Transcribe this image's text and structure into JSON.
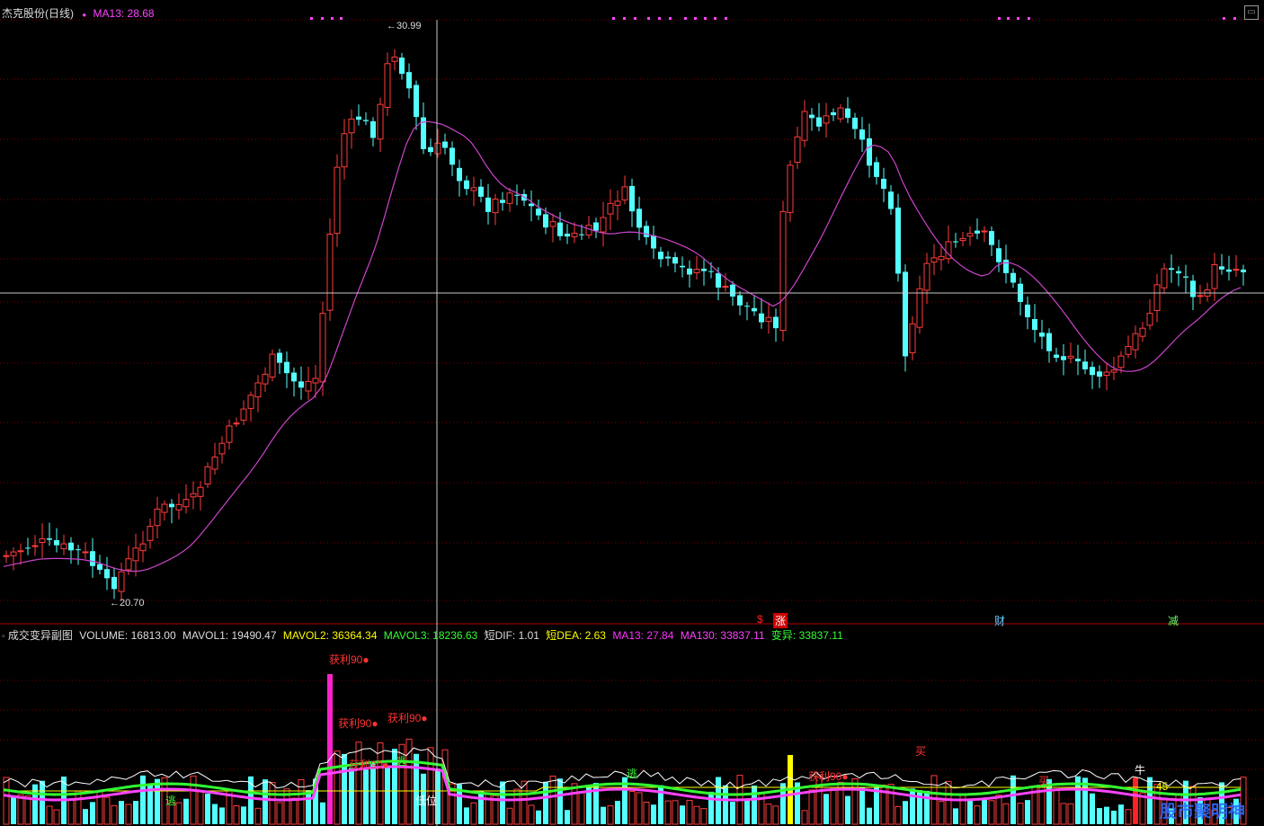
{
  "main_header": {
    "stock_name": "杰克股份(日线)",
    "ma_label": "MA13: 28.68",
    "ma_color": "#ff44ff"
  },
  "price_labels": {
    "high": "30.99",
    "low": "20.70"
  },
  "bottom_badges": [
    {
      "text": "$",
      "color": "#ff2020"
    },
    {
      "text": "涨",
      "color": "#ffffff"
    },
    {
      "text": "财",
      "color": "#66ccff"
    },
    {
      "text": "减",
      "color": "#66ff66"
    }
  ],
  "sub_header": {
    "panel_name": "成交变异副图",
    "items": [
      {
        "text": "VOLUME: 16813.00",
        "color": "#dddddd"
      },
      {
        "text": "MAVOL1: 19490.47",
        "color": "#dddddd"
      },
      {
        "text": "MAVOL2: 36364.34",
        "color": "#ffff00"
      },
      {
        "text": "MAVOL3: 18236.63",
        "color": "#33ff33"
      },
      {
        "text": "短DIF: 1.01",
        "color": "#dddddd"
      },
      {
        "text": "短DEA: 2.63",
        "color": "#ffff00"
      },
      {
        "text": "MA13: 27.84",
        "color": "#ff33ff"
      },
      {
        "text": "MA130: 33837.11",
        "color": "#ff44ff"
      },
      {
        "text": "变异: 33837.11",
        "color": "#33ff33"
      }
    ]
  },
  "sub_labels": [
    {
      "text": "获利90●",
      "color": "#ff3333"
    },
    {
      "text": "获利90●",
      "color": "#ff3333"
    },
    {
      "text": "获利90●",
      "color": "#ff3333"
    },
    {
      "text": "获利90●",
      "color": "#ff3333"
    },
    {
      "text": "获利90●",
      "color": "#ff3333"
    },
    {
      "text": "买",
      "color": "#ff3333"
    },
    {
      "text": "买",
      "color": "#ff3333"
    },
    {
      "text": "牛",
      "color": "#ffffff"
    },
    {
      "text": "逃",
      "color": "#33ff33"
    },
    {
      "text": "逃",
      "color": "#33ff33"
    },
    {
      "text": "逃",
      "color": "#33ff33"
    },
    {
      "text": "低位",
      "color": "#ffffff"
    },
    {
      "text": "45",
      "color": "#ffff00"
    }
  ],
  "watermark": "股市聚明神",
  "colors": {
    "up": "#ff3c3c",
    "down": "#54ffff",
    "ma13": "#cc44cc",
    "grid": "#7a0000",
    "crosshair": "#c8c8c8"
  },
  "controls": {
    "window_button": "▭",
    "toggle_button": "▫"
  }
}
